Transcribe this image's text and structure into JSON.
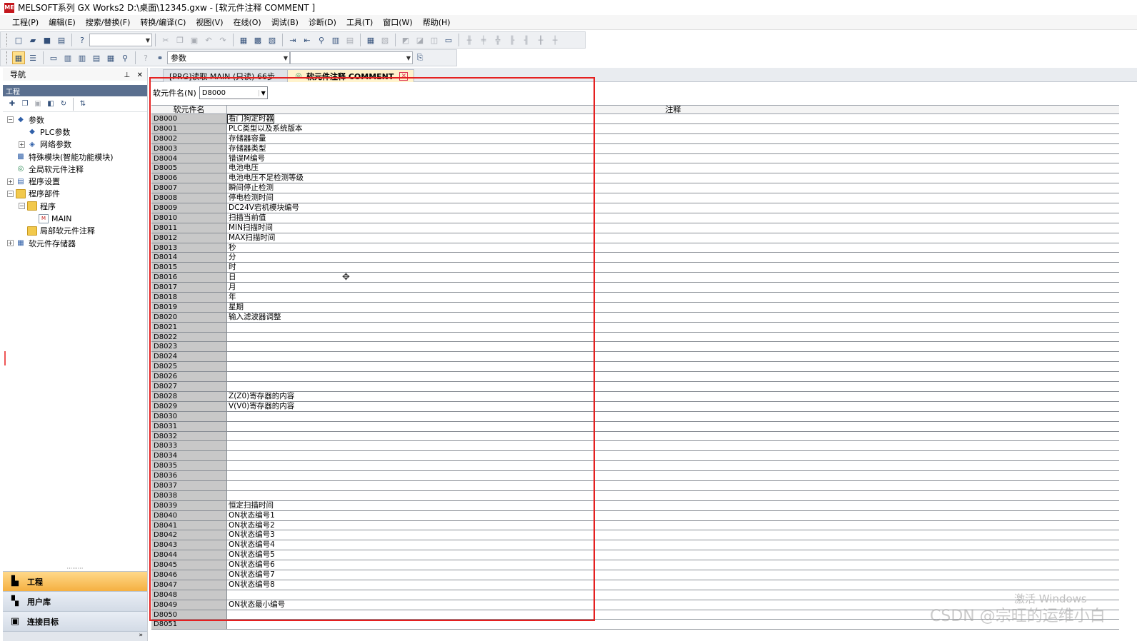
{
  "window": {
    "logo_text": "ME",
    "title": "MELSOFT系列 GX Works2 D:\\桌面\\12345.gxw - [软元件注释 COMMENT ]"
  },
  "menu": [
    "工程(P)",
    "编辑(E)",
    "搜索/替换(F)",
    "转换/编译(C)",
    "视图(V)",
    "在线(O)",
    "调试(B)",
    "诊断(D)",
    "工具(T)",
    "窗口(W)",
    "帮助(H)"
  ],
  "toolbar2": {
    "combo1_value": "参数",
    "combo2_value": ""
  },
  "navigation": {
    "title": "导航",
    "pin": "⊥",
    "close": "✕",
    "section": "工程",
    "tree": [
      {
        "label": "参数",
        "level": 0,
        "expander": "−",
        "icon": "param-icon"
      },
      {
        "label": "PLC参数",
        "level": 1,
        "expander": "",
        "icon": "param-icon"
      },
      {
        "label": "网络参数",
        "level": 1,
        "expander": "+",
        "icon": "network-icon"
      },
      {
        "label": "特殊模块(智能功能模块)",
        "level": 0,
        "expander": "",
        "icon": "module-icon"
      },
      {
        "label": "全局软元件注释",
        "level": 0,
        "expander": "",
        "icon": "globe-icon"
      },
      {
        "label": "程序设置",
        "level": 0,
        "expander": "+",
        "icon": "settings-icon"
      },
      {
        "label": "程序部件",
        "level": 0,
        "expander": "−",
        "icon": "folder-icon"
      },
      {
        "label": "程序",
        "level": 1,
        "expander": "−",
        "icon": "folder-icon"
      },
      {
        "label": "MAIN",
        "level": 2,
        "expander": "",
        "icon": "program-icon"
      },
      {
        "label": "局部软元件注释",
        "level": 1,
        "expander": "",
        "icon": "folder-icon"
      },
      {
        "label": "软元件存储器",
        "level": 0,
        "expander": "+",
        "icon": "memory-icon"
      }
    ],
    "bottom_tabs": [
      "工程",
      "用户库",
      "连接目标"
    ],
    "footer_arrow": "»"
  },
  "tabs": [
    {
      "label": "[PRG]读取 MAIN (只读) 66步",
      "active": false
    },
    {
      "label": "软元件注释 COMMENT",
      "active": true,
      "close": "✕"
    }
  ],
  "device_name": {
    "label": "软元件名(N)",
    "value": "D8000"
  },
  "grid": {
    "headers": [
      "软元件名",
      "注释"
    ],
    "rows": [
      {
        "device": "D8000",
        "comment": "看门狗定时器"
      },
      {
        "device": "D8001",
        "comment": "PLC类型以及系统版本"
      },
      {
        "device": "D8002",
        "comment": "存储器容量"
      },
      {
        "device": "D8003",
        "comment": "存储器类型"
      },
      {
        "device": "D8004",
        "comment": "错误M编号"
      },
      {
        "device": "D8005",
        "comment": "电池电压"
      },
      {
        "device": "D8006",
        "comment": "电池电压不足检测等级"
      },
      {
        "device": "D8007",
        "comment": "瞬间停止检测"
      },
      {
        "device": "D8008",
        "comment": "停电检测时间"
      },
      {
        "device": "D8009",
        "comment": "DC24V宕机模块编号"
      },
      {
        "device": "D8010",
        "comment": "扫描当前值"
      },
      {
        "device": "D8011",
        "comment": "MIN扫描时间"
      },
      {
        "device": "D8012",
        "comment": "MAX扫描时间"
      },
      {
        "device": "D8013",
        "comment": "秒"
      },
      {
        "device": "D8014",
        "comment": "分"
      },
      {
        "device": "D8015",
        "comment": "时"
      },
      {
        "device": "D8016",
        "comment": "日"
      },
      {
        "device": "D8017",
        "comment": "月"
      },
      {
        "device": "D8018",
        "comment": "年"
      },
      {
        "device": "D8019",
        "comment": "星期"
      },
      {
        "device": "D8020",
        "comment": "输入滤波器调整"
      },
      {
        "device": "D8021",
        "comment": ""
      },
      {
        "device": "D8022",
        "comment": ""
      },
      {
        "device": "D8023",
        "comment": ""
      },
      {
        "device": "D8024",
        "comment": ""
      },
      {
        "device": "D8025",
        "comment": ""
      },
      {
        "device": "D8026",
        "comment": ""
      },
      {
        "device": "D8027",
        "comment": ""
      },
      {
        "device": "D8028",
        "comment": "Z(Z0)寄存器的内容"
      },
      {
        "device": "D8029",
        "comment": "V(V0)寄存器的内容"
      },
      {
        "device": "D8030",
        "comment": ""
      },
      {
        "device": "D8031",
        "comment": ""
      },
      {
        "device": "D8032",
        "comment": ""
      },
      {
        "device": "D8033",
        "comment": ""
      },
      {
        "device": "D8034",
        "comment": ""
      },
      {
        "device": "D8035",
        "comment": ""
      },
      {
        "device": "D8036",
        "comment": ""
      },
      {
        "device": "D8037",
        "comment": ""
      },
      {
        "device": "D8038",
        "comment": ""
      },
      {
        "device": "D8039",
        "comment": "恒定扫描时间"
      },
      {
        "device": "D8040",
        "comment": "ON状态编号1"
      },
      {
        "device": "D8041",
        "comment": "ON状态编号2"
      },
      {
        "device": "D8042",
        "comment": "ON状态编号3"
      },
      {
        "device": "D8043",
        "comment": "ON状态编号4"
      },
      {
        "device": "D8044",
        "comment": "ON状态编号5"
      },
      {
        "device": "D8045",
        "comment": "ON状态编号6"
      },
      {
        "device": "D8046",
        "comment": "ON状态编号7"
      },
      {
        "device": "D8047",
        "comment": "ON状态编号8"
      },
      {
        "device": "D8048",
        "comment": ""
      },
      {
        "device": "D8049",
        "comment": "ON状态最小编号"
      },
      {
        "device": "D8050",
        "comment": ""
      },
      {
        "device": "D8051",
        "comment": ""
      }
    ]
  },
  "watermarks": {
    "activate": "激活 Windows",
    "csdn": "CSDN @宗旺的运维小白"
  },
  "colors": {
    "highlight_box": "#e52020",
    "device_cell_bg": "#c8c8c8",
    "active_bottom_tab": "#f5b041"
  }
}
